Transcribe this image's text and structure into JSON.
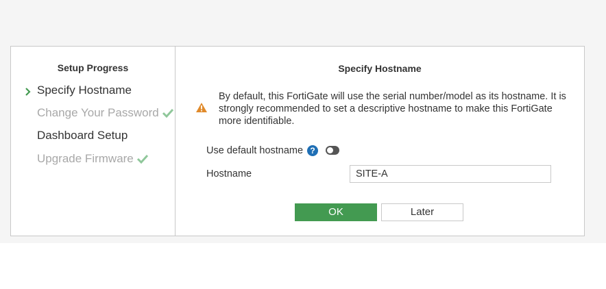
{
  "sidebar": {
    "title": "Setup Progress",
    "steps": [
      {
        "label": "Specify Hostname",
        "state": "active"
      },
      {
        "label": "Change Your Password",
        "state": "done"
      },
      {
        "label": "Dashboard Setup",
        "state": "pending"
      },
      {
        "label": "Upgrade Firmware",
        "state": "done"
      }
    ]
  },
  "main": {
    "title": "Specify Hostname",
    "warning": "By default, this FortiGate will use the serial number/model as its hostname. It is strongly recommended to set a descriptive hostname to make this FortiGate more identifiable.",
    "use_default_label": "Use default hostname",
    "help_symbol": "?",
    "use_default_enabled": false,
    "hostname_label": "Hostname",
    "hostname_value": "SITE-A"
  },
  "buttons": {
    "ok": "OK",
    "later": "Later"
  },
  "colors": {
    "accent_green": "#439a51",
    "check_green": "#8fc79a",
    "warning_orange": "#e08a2b",
    "help_blue": "#1f6fb5"
  },
  "icons": {
    "active_marker": "chevron-right-icon",
    "done_marker": "checkmark-icon",
    "warning": "warning-triangle-icon",
    "help": "help-circle-icon"
  }
}
